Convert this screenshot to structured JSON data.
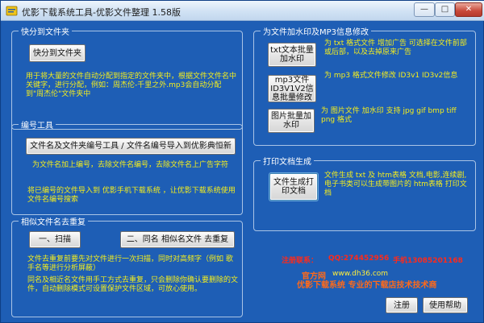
{
  "window": {
    "title": "优影下载系统工具-优影文件整理 1.58版",
    "controls": {
      "minimize": "—",
      "maximize": "□",
      "close": "✕"
    }
  },
  "group_move": {
    "legend": "快分到文件夹",
    "button": "快分到文件夹",
    "desc": "用于将大量的文件自动分配到指定的文件夹中，根据文件文件名中关键字，进行分配，例如：周杰伦-千里之外.mp3会自动分配到\"周杰伦\"文件夹中"
  },
  "group_number": {
    "legend": "编号工具",
    "button": "文件名及文件夹编号工具 / 文件名编号导入到优影典恒新",
    "desc1": "为文件名加上编号，去除文件名编号，去除文件名上广告字符",
    "desc2": "将已编号的文件导入到 优影手机下载系统 ，让优影下载系统使用文件名编号搜索"
  },
  "group_dedup": {
    "legend": "相似文件名去重复",
    "scan_button": "一、扫描",
    "same_button": "二、同名 相似名文件 去重复",
    "desc1": "文件去重复前要先对文件进行一次扫描，同时对高频字（例如 歌手名等进行分析屏蔽）",
    "desc2": "同名及相近名文件用手工方式去重复，只会删除你确认要删除的文件，自动删除模式可设置保护文件区域，可放心使用。"
  },
  "group_watermark": {
    "legend": "为文件加水印及MP3信息修改",
    "txt_button": "txt文本批量加水印",
    "txt_desc": "为 txt 格式文件 增加广告 可选择在文件前部或后部，以及去掉原来广告",
    "mp3_button": "mp3文件ID3V1V2信息批量修改",
    "mp3_desc": "为 mp3 格式文件修改 ID3v1 ID3v2信息",
    "img_button": "图片批量加水印",
    "img_desc": "为 图片文件 加水印 支持 jpg gif bmp tiff png 格式"
  },
  "group_print": {
    "legend": "打印文档生成",
    "button": "文件生成打印文档",
    "desc": "文件生成 txt 及 htm表格 文档,电影,连续剧,电子书类可以生成带图片的 htm表格 打印文档"
  },
  "contact": {
    "label": "注册联系：",
    "qq": "QQ:274452956",
    "phone": "手机13085201168"
  },
  "footer": {
    "site_prefix": "官方网",
    "site": "www.dh36.com",
    "slogan": "优影下载系统  专业的下载店技术技术商"
  },
  "bottom_buttons": {
    "register": "注册",
    "help": "使用帮助"
  },
  "colors": {
    "background": "#1e5eb5",
    "description_text": "#f5ee1c",
    "contact_text": "#ff2a1a",
    "footer_text": "#ff6a1a"
  }
}
